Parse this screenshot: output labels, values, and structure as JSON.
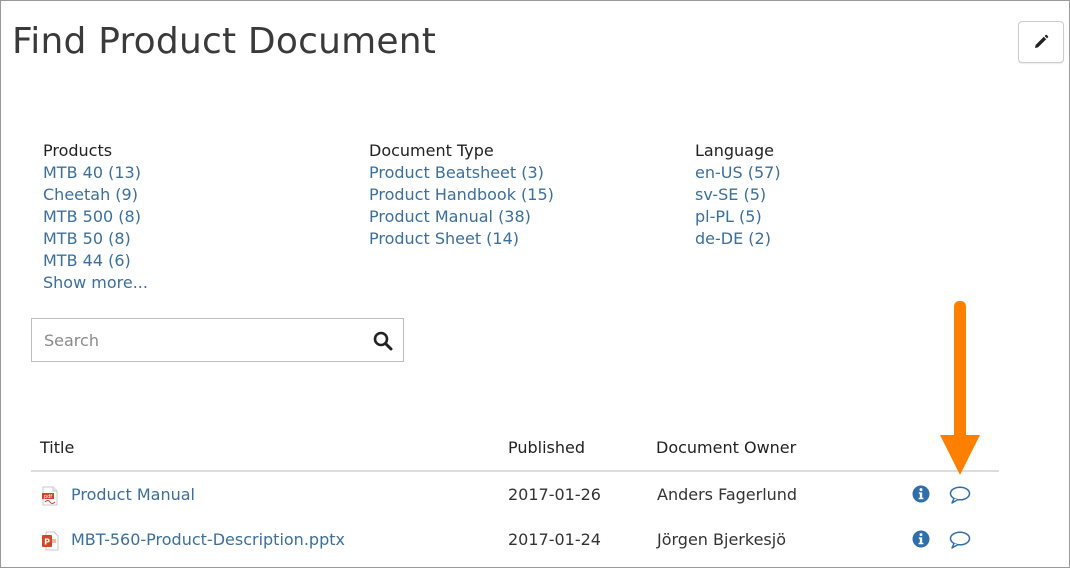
{
  "page": {
    "title": "Find Product Document"
  },
  "facets": {
    "products": {
      "heading": "Products",
      "items": [
        "MTB 40 (13)",
        "Cheetah (9)",
        "MTB 500 (8)",
        "MTB 50 (8)",
        "MTB 44 (6)"
      ],
      "show_more": "Show more..."
    },
    "document_type": {
      "heading": "Document Type",
      "items": [
        "Product Beatsheet (3)",
        "Product Handbook (15)",
        "Product Manual (38)",
        "Product Sheet (14)"
      ]
    },
    "language": {
      "heading": "Language",
      "items": [
        "en-US (57)",
        "sv-SE (5)",
        "pl-PL (5)",
        "de-DE (2)"
      ]
    }
  },
  "search": {
    "placeholder": "Search",
    "value": ""
  },
  "results": {
    "columns": [
      "Title",
      "Published",
      "Document Owner"
    ],
    "rows": [
      {
        "icon": "pdf-file-icon",
        "title": "Product Manual",
        "published": "2017-01-26",
        "owner": "Anders Fagerlund"
      },
      {
        "icon": "pptx-file-icon",
        "title": "MBT-560-Product-Description.pptx",
        "published": "2017-01-24",
        "owner": "Jörgen Bjerkesjö"
      }
    ]
  },
  "icons": {
    "edit": "pencil-icon",
    "search": "search-icon",
    "info": "info-icon",
    "comment": "comment-bubble-icon",
    "callout": "arrow-down-annotation"
  },
  "colors": {
    "link": "#3b6f9e",
    "info": "#2f6ea8",
    "pdf": "#d0452c",
    "pptx": "#d24726",
    "callout_arrow": "#ff8000"
  }
}
